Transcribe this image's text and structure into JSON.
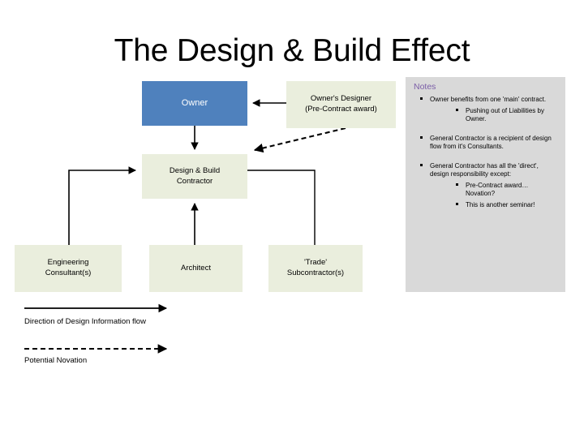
{
  "slide": {
    "title": "The Design & Build Effect"
  },
  "diagram": {
    "boxes": [
      {
        "id": "owner",
        "label": "Owner",
        "color": "#4f81bd",
        "text_color": "#ffffff"
      },
      {
        "id": "owners-designer",
        "label": "Owner's Designer\n(Pre-Contract award)",
        "color": "#eaeedd",
        "text_color": "#000000"
      },
      {
        "id": "db-contractor",
        "label": "Design & Build\nContractor",
        "color": "#eaeedd",
        "text_color": "#000000"
      },
      {
        "id": "engineering",
        "label": "Engineering\nConsultant(s)",
        "color": "#eaeedd",
        "text_color": "#000000"
      },
      {
        "id": "architect",
        "label": "Architect",
        "color": "#eaeedd",
        "text_color": "#000000"
      },
      {
        "id": "trade",
        "label": "'Trade'\nSubcontractor(s)",
        "color": "#eaeedd",
        "text_color": "#000000"
      }
    ],
    "box_labels": {
      "owner": "Owner",
      "owners_designer_line1": "Owner's Designer",
      "owners_designer_line2": "(Pre-Contract award)",
      "db_contractor_line1": "Design & Build",
      "db_contractor_line2": "Contractor",
      "engineering_line1": "Engineering",
      "engineering_line2": "Consultant(s)",
      "architect": "Architect",
      "trade_line1": "'Trade'",
      "trade_line2": "Subcontractor(s)"
    }
  },
  "legend": {
    "flow_label": "Direction of Design Information flow",
    "novation_label": "Potential Novation"
  },
  "notes": {
    "heading": "Notes",
    "items": [
      {
        "level": 1,
        "text": "Owner benefits from one 'main' contract."
      },
      {
        "level": 2,
        "text": "Pushing out of Liabilities by Owner."
      },
      {
        "level": 1,
        "text": "General Contractor is a recipient of design flow from it's Consultants."
      },
      {
        "level": 1,
        "text": "General Contractor has all the 'direct', design responsibility except:"
      },
      {
        "level": 2,
        "text": "Pre-Contract award… Novation?"
      },
      {
        "level": 2,
        "text": "This is another seminar!"
      }
    ]
  },
  "colors": {
    "accent_blue": "#4f81bd",
    "box_cream": "#eaeedd",
    "notes_bg": "#d9d9d9",
    "notes_heading": "#7b5ea7",
    "connector": "#000000"
  }
}
